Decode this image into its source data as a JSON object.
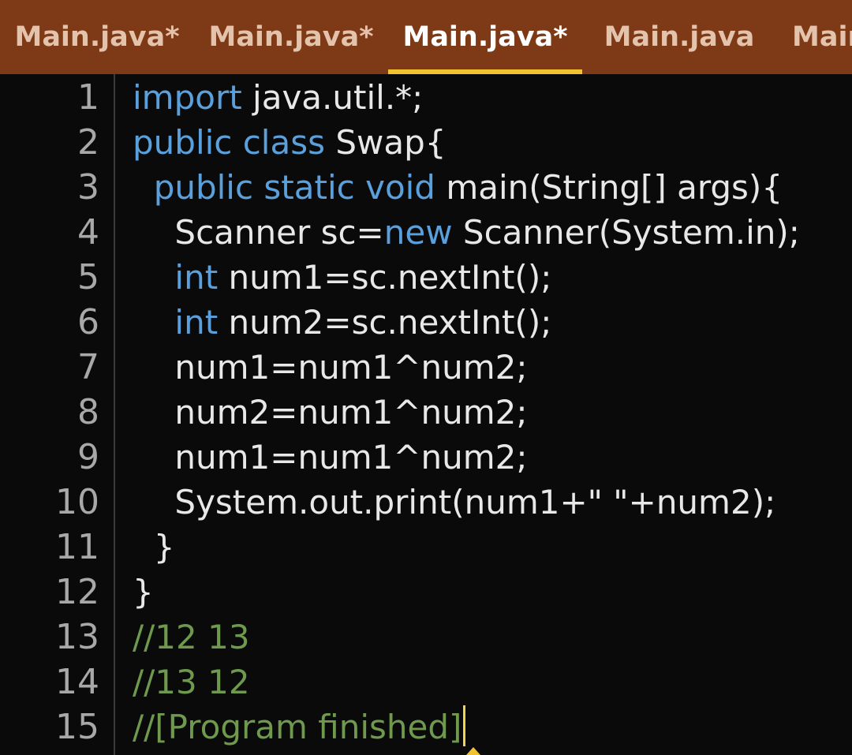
{
  "tabs": [
    {
      "label": "Main.java*",
      "active": false
    },
    {
      "label": "Main.java*",
      "active": false
    },
    {
      "label": "Main.java*",
      "active": true
    },
    {
      "label": "Main.java",
      "active": false
    },
    {
      "label": "Main",
      "active": false
    }
  ],
  "editor": {
    "lines": [
      {
        "num": "1",
        "tokens": [
          {
            "t": "import",
            "c": "kw"
          },
          {
            "t": " java.util.*;",
            "c": ""
          }
        ]
      },
      {
        "num": "2",
        "tokens": [
          {
            "t": "public class",
            "c": "kw"
          },
          {
            "t": " Swap{",
            "c": ""
          }
        ]
      },
      {
        "num": "3",
        "tokens": [
          {
            "t": "  ",
            "c": ""
          },
          {
            "t": "public static void",
            "c": "kw"
          },
          {
            "t": " main(String[] args){",
            "c": ""
          }
        ]
      },
      {
        "num": "4",
        "tokens": [
          {
            "t": "    Scanner sc=",
            "c": ""
          },
          {
            "t": "new",
            "c": "kw"
          },
          {
            "t": " Scanner(System.in);",
            "c": ""
          }
        ]
      },
      {
        "num": "5",
        "tokens": [
          {
            "t": "    ",
            "c": ""
          },
          {
            "t": "int",
            "c": "kw"
          },
          {
            "t": " num1=sc.nextInt();",
            "c": ""
          }
        ]
      },
      {
        "num": "6",
        "tokens": [
          {
            "t": "    ",
            "c": ""
          },
          {
            "t": "int",
            "c": "kw"
          },
          {
            "t": " num2=sc.nextInt();",
            "c": ""
          }
        ]
      },
      {
        "num": "7",
        "tokens": [
          {
            "t": "    num1=num1^num2;",
            "c": ""
          }
        ]
      },
      {
        "num": "8",
        "tokens": [
          {
            "t": "    num2=num1^num2;",
            "c": ""
          }
        ]
      },
      {
        "num": "9",
        "tokens": [
          {
            "t": "    num1=num1^num2;",
            "c": ""
          }
        ]
      },
      {
        "num": "10",
        "tokens": [
          {
            "t": "    System.out.print(num1+\" \"+num2);",
            "c": ""
          }
        ]
      },
      {
        "num": "11",
        "tokens": [
          {
            "t": "  }",
            "c": ""
          }
        ]
      },
      {
        "num": "12",
        "tokens": [
          {
            "t": "}",
            "c": ""
          }
        ]
      },
      {
        "num": "13",
        "tokens": [
          {
            "t": "//12 13",
            "c": "cm"
          }
        ]
      },
      {
        "num": "14",
        "tokens": [
          {
            "t": "//13 12",
            "c": "cm"
          }
        ]
      },
      {
        "num": "15",
        "tokens": [
          {
            "t": "//[Program finished]",
            "c": "cm"
          }
        ]
      }
    ],
    "cursor_line": 15
  },
  "colors": {
    "tabbar_bg": "#7e3a17",
    "active_indicator": "#f2c230",
    "keyword": "#5aa0dd",
    "comment": "#6f9a4d",
    "text": "#e8e8e8",
    "line_number": "#a8a8a8",
    "editor_bg": "#0a0a0a"
  }
}
